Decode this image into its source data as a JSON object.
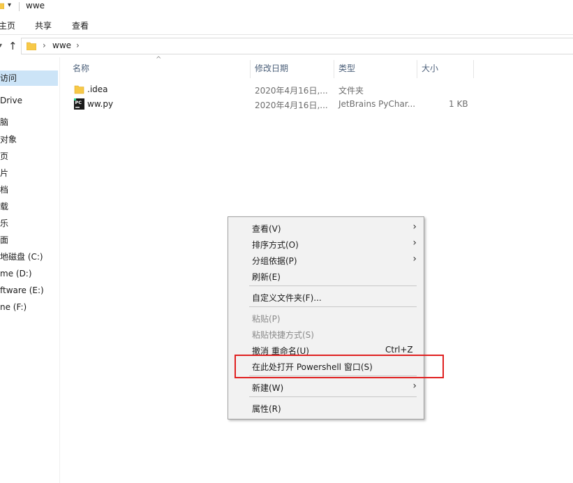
{
  "window": {
    "title": "wwe"
  },
  "ribbon": {
    "tabs": [
      "主页",
      "共享",
      "查看"
    ]
  },
  "address": {
    "crumb": "wwe",
    "chevron": "›"
  },
  "nav_pane": {
    "items": [
      {
        "label": "访问",
        "selected": true
      },
      {
        "label": "Drive",
        "selected": false
      },
      {
        "label": "脑",
        "selected": false
      },
      {
        "label": "对象",
        "selected": false
      },
      {
        "label": "页",
        "selected": false
      },
      {
        "label": "片",
        "selected": false
      },
      {
        "label": "档",
        "selected": false
      },
      {
        "label": "载",
        "selected": false
      },
      {
        "label": "乐",
        "selected": false
      },
      {
        "label": "面",
        "selected": false
      },
      {
        "label": "地磁盘 (C:)",
        "selected": false
      },
      {
        "label": "me (D:)",
        "selected": false
      },
      {
        "label": "ftware (E:)",
        "selected": false
      },
      {
        "label": "ne (F:)",
        "selected": false
      }
    ]
  },
  "columns": {
    "name": "名称",
    "modified": "修改日期",
    "type": "类型",
    "size": "大小"
  },
  "files": [
    {
      "name": ".idea",
      "modified": "2020年4月16日,...",
      "type": "文件夹",
      "size": "",
      "icon": "folder-icon"
    },
    {
      "name": "ww.py",
      "modified": "2020年4月16日,...",
      "type": "JetBrains PyChar...",
      "size": "1 KB",
      "icon": "pycharm-file-icon"
    }
  ],
  "context_menu": {
    "view": "查看(V)",
    "sort": "排序方式(O)",
    "group": "分组依据(P)",
    "refresh": "刷新(E)",
    "customize": "自定义文件夹(F)...",
    "paste": "粘贴(P)",
    "paste_shortcut": "粘贴快捷方式(S)",
    "undo": "撤消 重命名(U)",
    "undo_shortcut": "Ctrl+Z",
    "powershell": "在此处打开 Powershell 窗口(S)",
    "new": "新建(W)",
    "properties": "属性(R)",
    "submenu_arrow": "›"
  },
  "colors": {
    "selection": "#cce4f7",
    "folder": "#f7c948",
    "highlight": "#e02020",
    "header_text": "#4c607a"
  }
}
